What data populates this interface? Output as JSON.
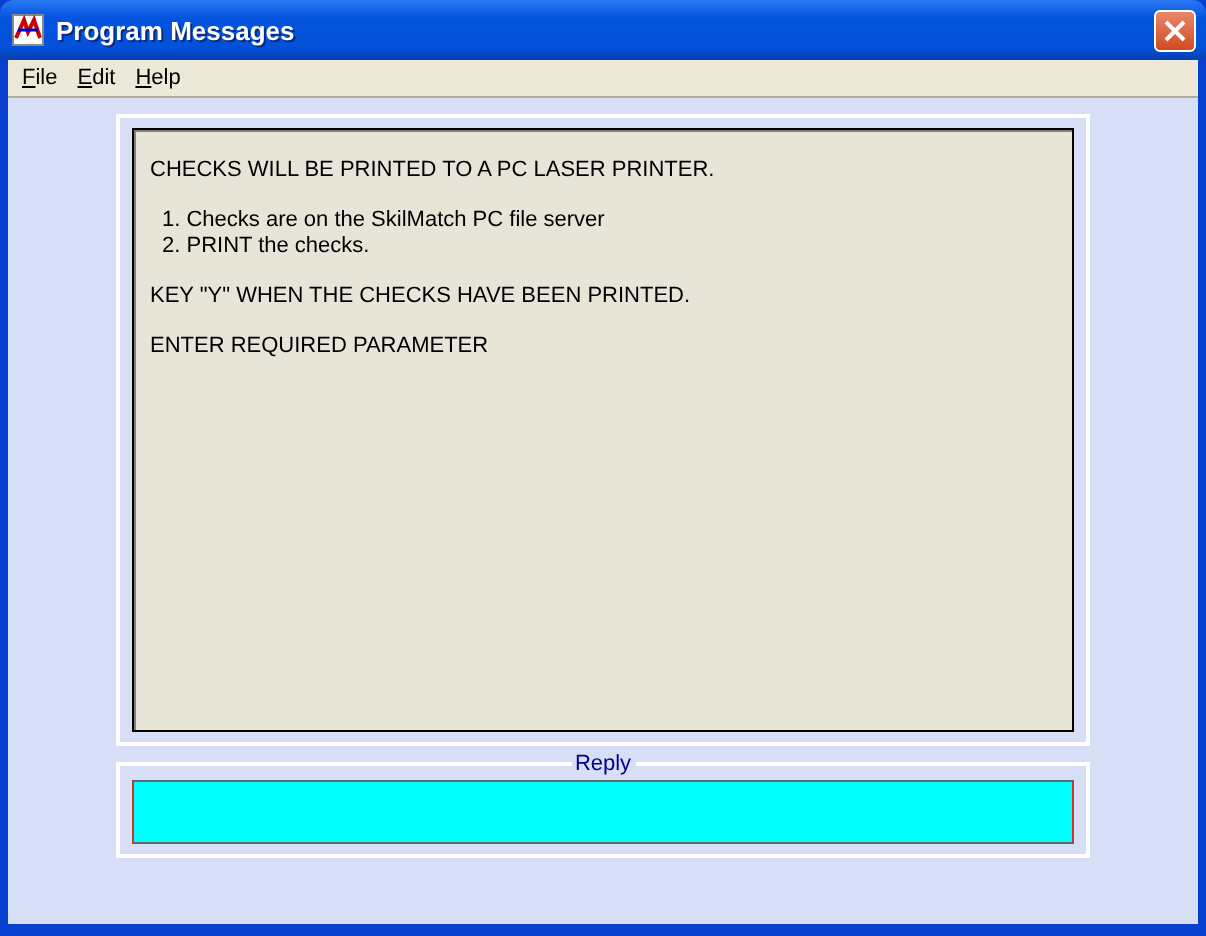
{
  "window": {
    "title": "Program Messages"
  },
  "menu": [
    {
      "label": "File"
    },
    {
      "label": "Edit"
    },
    {
      "label": "Help"
    }
  ],
  "message": {
    "paragraphs": [
      {
        "kind": "text",
        "lines": [
          "CHECKS WILL BE PRINTED TO A PC LASER PRINTER."
        ]
      },
      {
        "kind": "list",
        "lines": [
          "1. Checks are on the SkilMatch PC file server",
          "2. PRINT the checks."
        ]
      },
      {
        "kind": "text",
        "lines": [
          "KEY \"Y\" WHEN THE CHECKS HAVE BEEN PRINTED."
        ]
      },
      {
        "kind": "text",
        "lines": [
          "ENTER REQUIRED PARAMETER"
        ]
      }
    ]
  },
  "reply": {
    "label": "Reply"
  }
}
